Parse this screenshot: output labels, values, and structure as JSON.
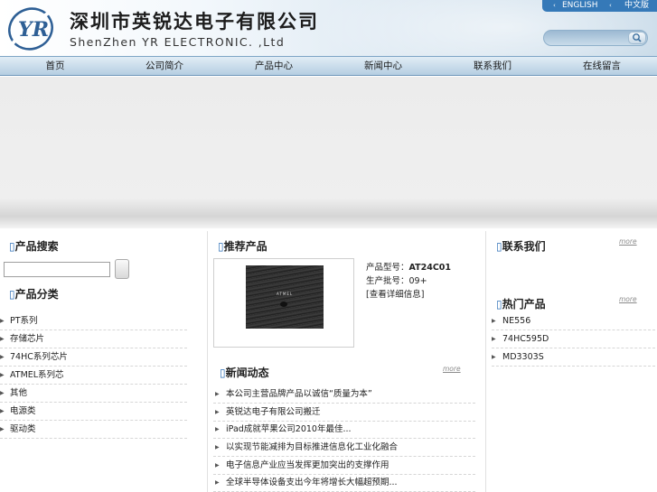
{
  "header": {
    "company_cn": "深圳市英锐达电子有限公司",
    "company_en": "ShenZhen YR ELECTRONIC. ,Ltd",
    "logo_text": "YR",
    "lang_english": "ENGLISH",
    "lang_chinese": "中文版",
    "search_placeholder": ""
  },
  "nav": [
    "首页",
    "公司简介",
    "产品中心",
    "新闻中心",
    "联系我们",
    "在线留言"
  ],
  "left": {
    "search_title": "产品搜索",
    "category_title": "产品分类",
    "categories": [
      "PT系列",
      "存储芯片",
      "74HC系列芯片",
      "ATMEL系列芯",
      "其他",
      "电源类",
      "驱动类"
    ]
  },
  "middle": {
    "product_title": "推荐产品",
    "chip_label": "ATMEL",
    "product_model_label": "产品型号：",
    "product_model": "AT24C01",
    "product_batch": "生产批号：09+",
    "product_detail": "[查看详细信息]",
    "news_title": "新闻动态",
    "news_more": "more",
    "news": [
      "本公司主营品牌产品以诚信“质量为本”",
      "英锐达电子有限公司搬迁",
      "iPad成就苹果公司2010年最佳...",
      "以实现节能减排为目标推进信息化工业化融合",
      "电子信息产业应当发挥更加突出的支撑作用",
      "全球半导体设备支出今年将增长大幅超预期..."
    ]
  },
  "right": {
    "contact_title": "联系我们",
    "contact_more": "more",
    "hot_title": "热门产品",
    "hot_more": "more",
    "hot": [
      "NE556",
      "74HC595D",
      "MD3303S"
    ]
  },
  "colors": {
    "accent": "#2d6fb7",
    "lang_bar": "#3579b8",
    "nav_top": "#e1edf6",
    "nav_bottom": "#b5cee2"
  },
  "icons": {
    "search_button": "magnifier-icon",
    "list_bullet": "triangle-right-icon",
    "title_marker": "square-marker-icon"
  }
}
